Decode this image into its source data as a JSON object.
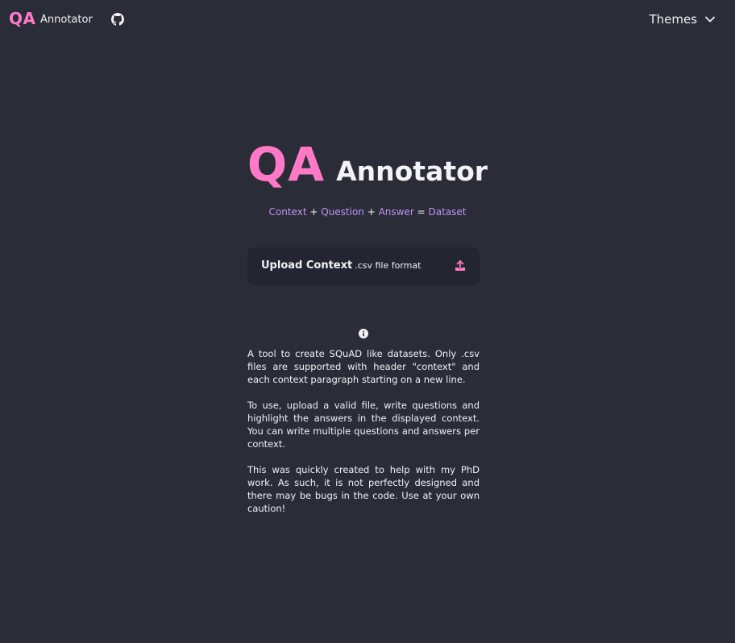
{
  "header": {
    "brand_qa": "QA",
    "brand_name": "Annotator",
    "github_icon": "github-icon",
    "themes_label": "Themes",
    "themes_icon": "chevron-down-icon"
  },
  "hero": {
    "qa": "QA",
    "name": "Annotator"
  },
  "formula": {
    "context": "Context",
    "plus1": " + ",
    "question": "Question",
    "plus2": " + ",
    "answer": "Answer",
    "equals": " = ",
    "dataset": "Dataset"
  },
  "upload": {
    "label": "Upload Context",
    "sub": ".csv file format",
    "icon": "upload-icon"
  },
  "about": {
    "icon": "info-icon",
    "paragraphs": [
      "A tool to create SQuAD like datasets. Only .csv files are supported with header \"context\" and each context paragraph starting on a new line.",
      "To use, upload a valid file, write questions and highlight the answers in the displayed context. You can write multiple questions and answers per context.",
      "This was quickly created to help with my PhD work. As such, it is not perfectly designed and there may be bugs in the code. Use at your own caution!"
    ]
  },
  "colors": {
    "background": "#2a2c37",
    "accent_pink": "#ff79c6",
    "accent_purple": "#bd93f9",
    "card": "#232530",
    "text": "#f2f2f7"
  }
}
